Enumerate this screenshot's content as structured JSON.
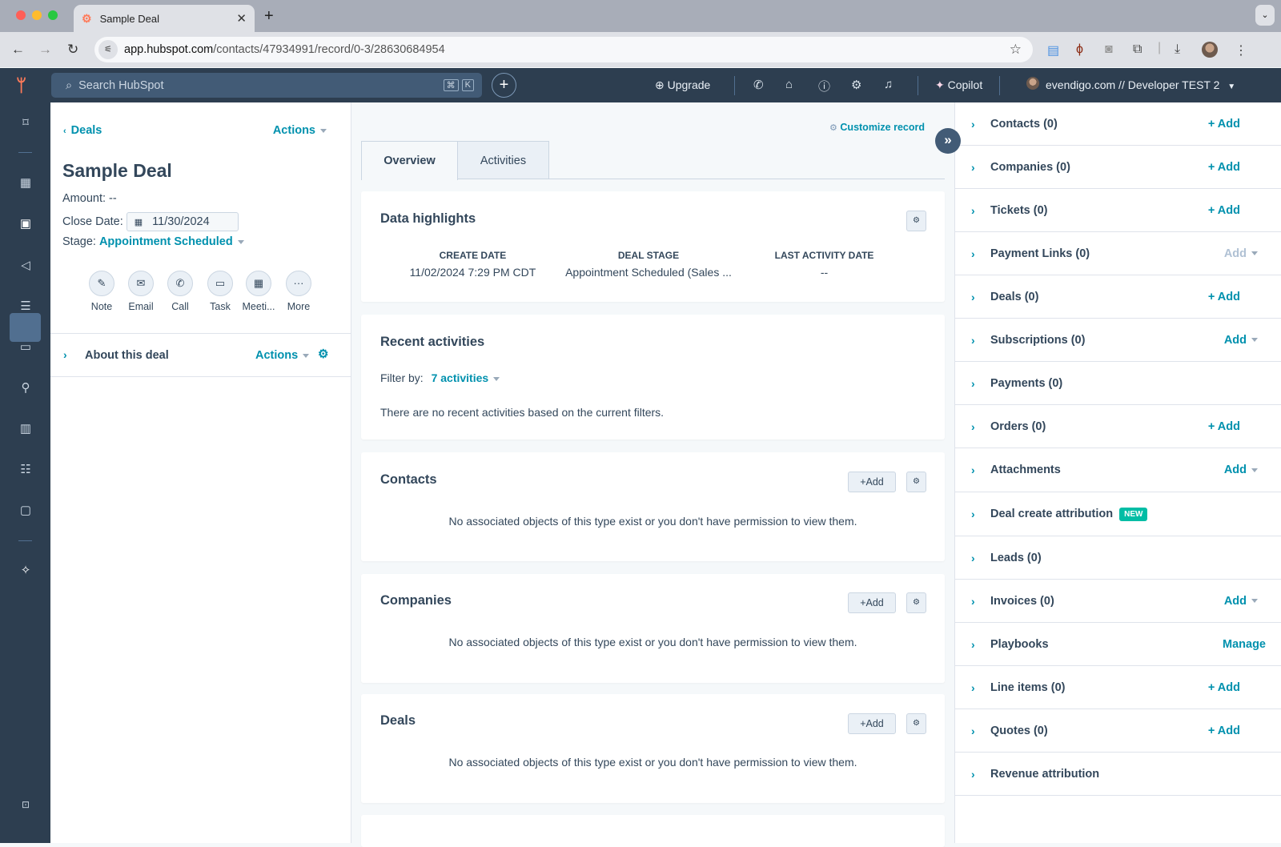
{
  "browser": {
    "tab_title": "Sample Deal",
    "url_host": "app.hubspot.com",
    "url_path": "/contacts/47934991/record/0-3/28630684954",
    "icons": [
      "back-icon",
      "forward-icon",
      "reload-icon",
      "site-settings-icon",
      "bookmark-star-icon",
      "extension-icon",
      "hubspot-extension-icon",
      "camera-icon",
      "puzzle-icon",
      "download-icon",
      "profile-avatar",
      "menu-kebab-icon"
    ]
  },
  "topnav": {
    "search_placeholder": "Search HubSpot",
    "kbd_cmd": "⌘",
    "kbd_k": "K",
    "upgrade_label": "Upgrade",
    "copilot_label": "Copilot",
    "account_label": "evendigo.com // Developer TEST 2",
    "icons": [
      "calling-icon",
      "marketplace-icon",
      "help-icon",
      "settings-icon",
      "notifications-icon"
    ]
  },
  "rail": {
    "items": [
      "bookmarks",
      "workspaces",
      "crm",
      "marketing",
      "content",
      "commerce",
      "automation",
      "reporting",
      "data-management",
      "library",
      "breeze"
    ]
  },
  "record": {
    "back_label": "Deals",
    "actions_label": "Actions",
    "title": "Sample Deal",
    "amount_label": "Amount:",
    "amount_value": "--",
    "close_date_label": "Close Date:",
    "close_date_value": "11/30/2024",
    "stage_label": "Stage:",
    "stage_value": "Appointment Scheduled",
    "activity_buttons": [
      {
        "label": "Note",
        "icon": "note-icon"
      },
      {
        "label": "Email",
        "icon": "email-icon"
      },
      {
        "label": "Call",
        "icon": "call-icon"
      },
      {
        "label": "Task",
        "icon": "task-icon"
      },
      {
        "label": "Meeti...",
        "icon": "meeting-icon"
      },
      {
        "label": "More",
        "icon": "more-icon"
      }
    ],
    "about_label": "About this deal",
    "about_actions_label": "Actions"
  },
  "middle": {
    "customize_label": "Customize record",
    "tabs": [
      {
        "label": "Overview",
        "active": true
      },
      {
        "label": "Activities",
        "active": false
      }
    ],
    "highlights": {
      "title": "Data highlights",
      "columns": [
        {
          "header": "CREATE DATE",
          "value": "11/02/2024 7:29 PM CDT"
        },
        {
          "header": "DEAL STAGE",
          "value": "Appointment Scheduled (Sales ..."
        },
        {
          "header": "LAST ACTIVITY DATE",
          "value": "--"
        }
      ]
    },
    "recent": {
      "title": "Recent activities",
      "filter_label": "Filter by:",
      "filter_value": "7 activities",
      "empty": "There are no recent activities based on the current filters."
    },
    "assoc_cards": [
      {
        "title": "Contacts",
        "add_label": "+Add",
        "empty": "No associated objects of this type exist or you don't have permission to view them."
      },
      {
        "title": "Companies",
        "add_label": "+Add",
        "empty": "No associated objects of this type exist or you don't have permission to view them."
      },
      {
        "title": "Deals",
        "add_label": "+Add",
        "empty": "No associated objects of this type exist or you don't have permission to view them."
      }
    ]
  },
  "sidebar": {
    "items": [
      {
        "label": "Contacts (0)",
        "action": "+ Add"
      },
      {
        "label": "Companies (0)",
        "action": "+ Add"
      },
      {
        "label": "Tickets (0)",
        "action": "+ Add"
      },
      {
        "label": "Payment Links (0)",
        "action": "Add",
        "dropdown": true,
        "disabled": true
      },
      {
        "label": "Deals (0)",
        "action": "+ Add"
      },
      {
        "label": "Subscriptions (0)",
        "action": "Add",
        "dropdown": true
      },
      {
        "label": "Payments (0)",
        "action": ""
      },
      {
        "label": "Orders (0)",
        "action": "+ Add"
      },
      {
        "label": "Attachments",
        "action": "Add",
        "dropdown": true
      },
      {
        "label": "Deal create attribution",
        "action": "",
        "badge": "NEW"
      },
      {
        "label": "Leads (0)",
        "action": ""
      },
      {
        "label": "Invoices (0)",
        "action": "Add",
        "dropdown": true
      },
      {
        "label": "Playbooks",
        "action": "Manage"
      },
      {
        "label": "Line items (0)",
        "action": "+ Add"
      },
      {
        "label": "Quotes (0)",
        "action": "+ Add"
      },
      {
        "label": "Revenue attribution",
        "action": ""
      }
    ]
  },
  "colors": {
    "accent": "#0091ae",
    "nav": "#2d3e50",
    "brand": "#ff7a59",
    "badge": "#00bda5"
  }
}
